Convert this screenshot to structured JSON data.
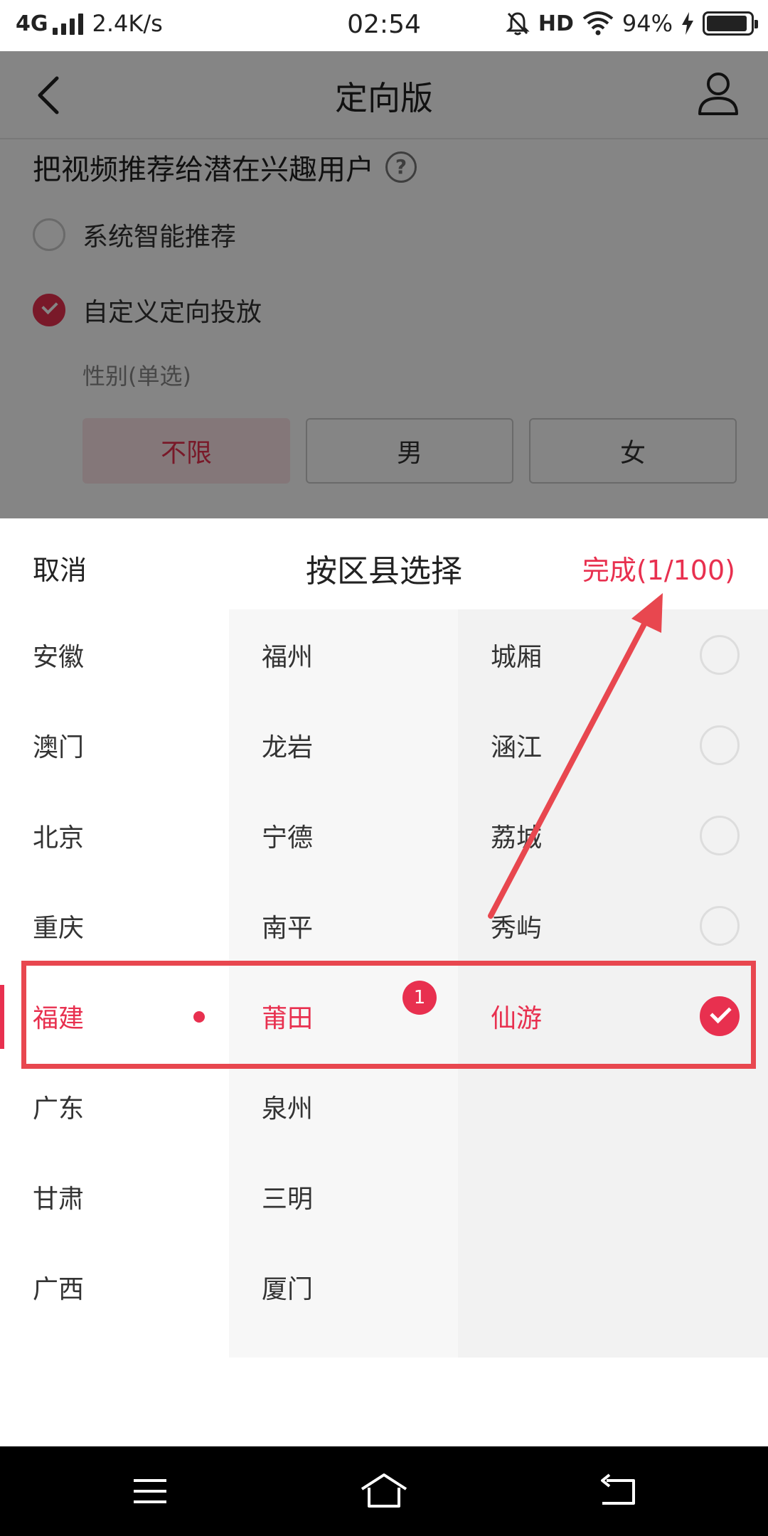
{
  "status_bar": {
    "network": "4G",
    "speed": "2.4K/s",
    "time": "02:54",
    "hd": "HD",
    "battery": "94%"
  },
  "nav": {
    "title": "定向版"
  },
  "page": {
    "heading": "把视频推荐给潜在兴趣用户",
    "options": [
      {
        "label": "系统智能推荐",
        "selected": false
      },
      {
        "label": "自定义定向投放",
        "selected": true
      }
    ],
    "gender_label": "性别(单选)",
    "gender_options": [
      {
        "label": "不限",
        "selected": true
      },
      {
        "label": "男",
        "selected": false
      },
      {
        "label": "女",
        "selected": false
      }
    ]
  },
  "sheet": {
    "cancel": "取消",
    "title": "按区县选择",
    "done": "完成(1/100)",
    "provinces": [
      "安徽",
      "澳门",
      "北京",
      "重庆",
      "福建",
      "广东",
      "甘肃",
      "广西"
    ],
    "cities": [
      "福州",
      "龙岩",
      "宁德",
      "南平",
      "莆田",
      "泉州",
      "三明",
      "厦门"
    ],
    "city_badge": "1",
    "districts": [
      {
        "label": "城厢",
        "checked": false
      },
      {
        "label": "涵江",
        "checked": false
      },
      {
        "label": "荔城",
        "checked": false
      },
      {
        "label": "秀屿",
        "checked": false
      },
      {
        "label": "仙游",
        "checked": true
      }
    ]
  },
  "colors": {
    "accent": "#e8304f",
    "annotation": "#e8474f"
  },
  "icons": {
    "back": "back-arrow-icon",
    "user": "user-icon",
    "help": "help-icon",
    "menu": "menu-icon",
    "home": "home-icon",
    "return": "return-icon"
  }
}
